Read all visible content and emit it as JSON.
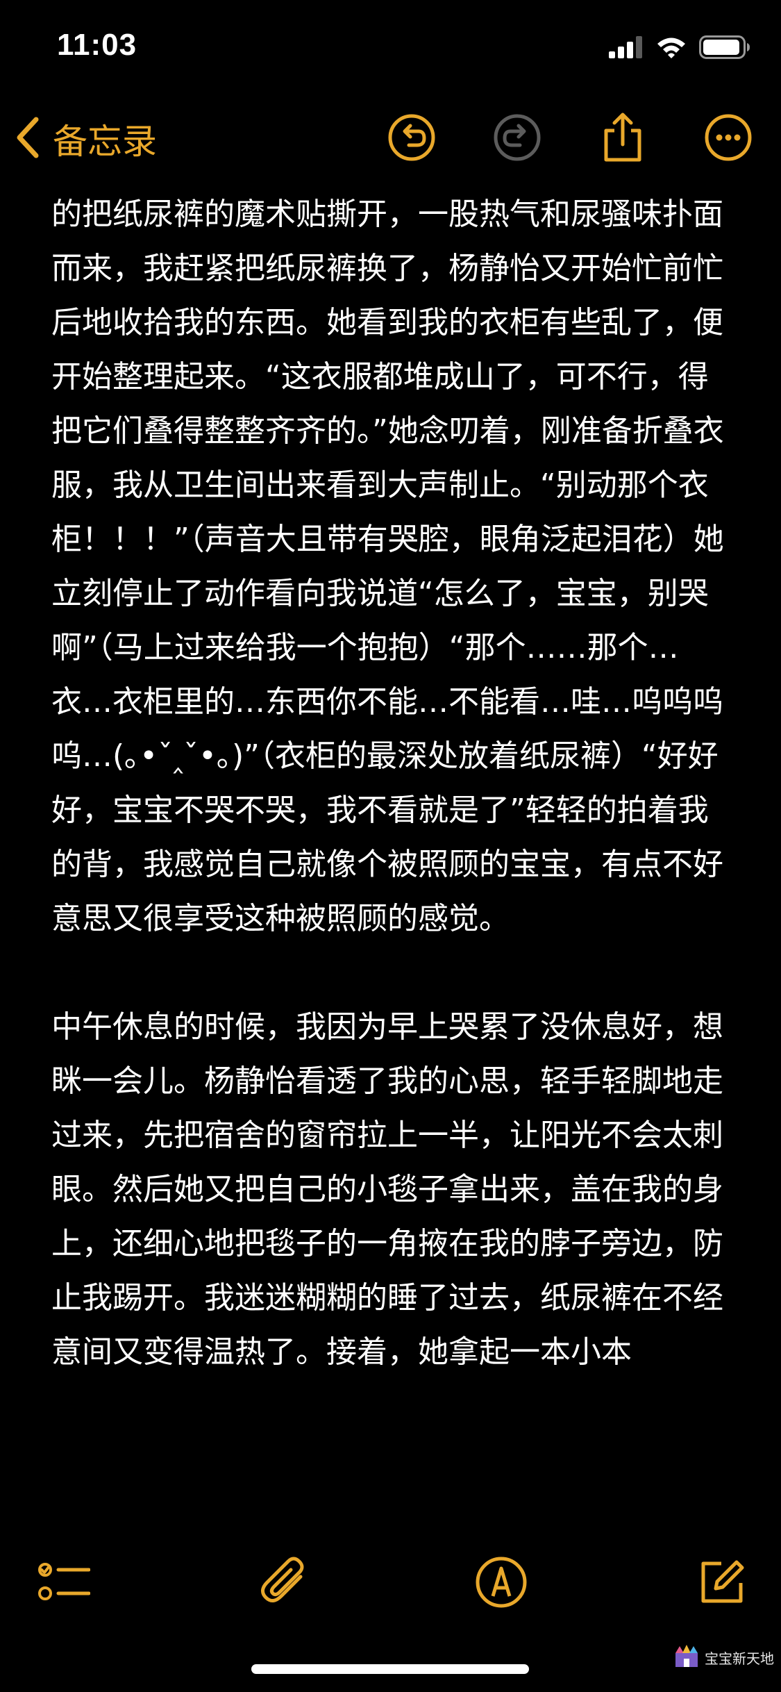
{
  "status_bar": {
    "time": "11:03",
    "icons": [
      "cellular-signal-icon",
      "wifi-icon",
      "battery-icon"
    ]
  },
  "nav": {
    "back_label": "备忘录",
    "icons": [
      "undo-icon",
      "redo-icon",
      "share-icon",
      "more-icon"
    ]
  },
  "note": {
    "text": "的把纸尿裤的魔术贴撕开，一股热气和尿骚味扑面而来，我赶紧把纸尿裤换了，杨静怡又开始忙前忙后地收拾我的东西。她看到我的衣柜有些乱了，便开始整理起来。“这衣服都堆成山了，可不行，得把它们叠得整整齐齐的。”她念叨着，刚准备折叠衣服，我从卫生间出来看到大声制止。“别动那个衣柜！！！”（声音大且带有哭腔，眼角泛起泪花）她立刻停止了动作看向我说道“怎么了，宝宝，别哭啊”（马上过来给我一个抱抱）“那个……那个…衣…衣柜里的…东西你不能…不能看…哇…呜呜呜呜…(｡•ˇ‸ˇ•｡)”（衣柜的最深处放着纸尿裤）“好好好，宝宝不哭不哭，我不看就是了”轻轻的拍着我的背，我感觉自己就像个被照顾的宝宝，有点不好意思又很享受这种被照顾的感觉。\n\n中午休息的时候，我因为早上哭累了没休息好，想眯一会儿。杨静怡看透了我的心思，轻手轻脚地走过来，先把宿舍的窗帘拉上一半，让阳光不会太刺眼。然后她又把自己的小毯子拿出来，盖在我的身上，还细心地把毯子的一角掖在我的脖子旁边，防止我踢开。我迷迷糊糊的睡了过去，纸尿裤在不经意间又变得温热了。接着，她拿起一本小本"
  },
  "toolbar": {
    "icons": [
      "checklist-icon",
      "attachment-icon",
      "markup-icon",
      "compose-icon"
    ]
  },
  "watermark": {
    "text": "宝宝新天地"
  },
  "colors": {
    "accent": "#E9A82B",
    "background": "#000000",
    "text": "#FFFFFF"
  }
}
